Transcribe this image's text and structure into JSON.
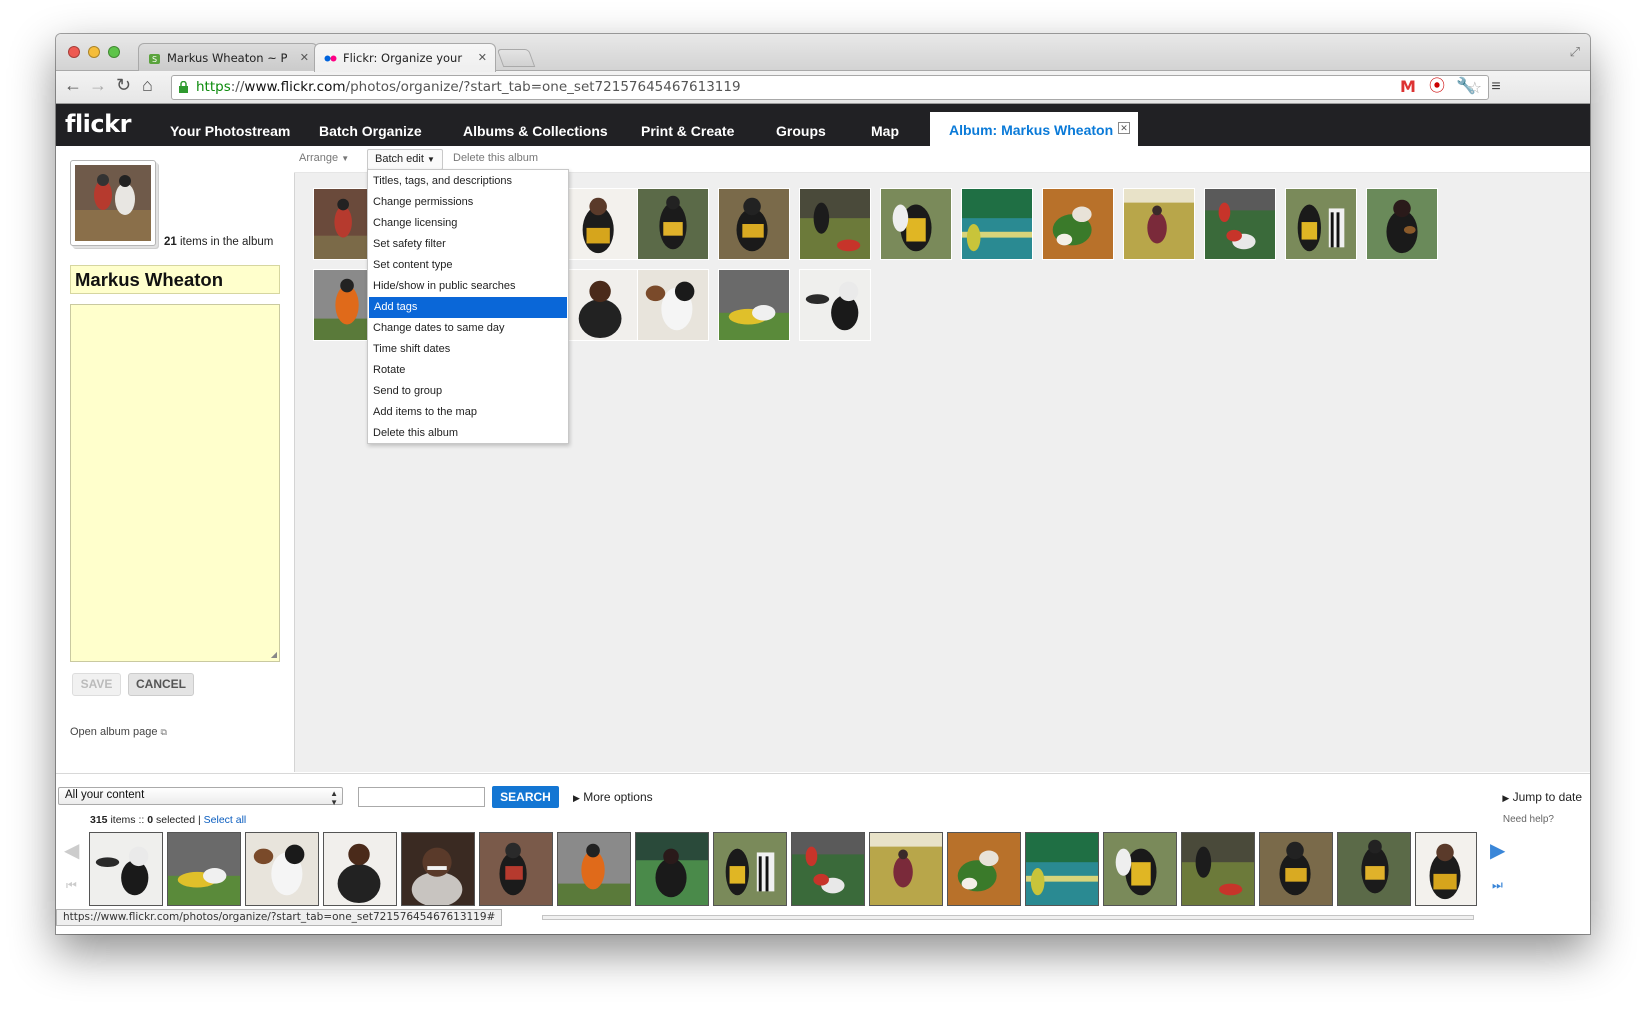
{
  "browser": {
    "tabs": [
      {
        "title": "Markus Wheaton ~ Pages -",
        "active": false
      },
      {
        "title": "Flickr: Organize your phot",
        "active": true
      }
    ],
    "url_https": "https",
    "url_sep": "://",
    "url_domain": "www.flickr.com",
    "url_path": "/photos/organize/?start_tab=one_set72157645467613119",
    "status_url": "https://www.flickr.com/photos/organize/?start_tab=one_set72157645467613119#"
  },
  "flickr_nav": {
    "logo": "flickr",
    "items": [
      "Your Photostream",
      "Batch Organize",
      "Albums & Collections",
      "Print & Create",
      "Groups",
      "Map"
    ],
    "album_tab": "Album: Markus Wheaton"
  },
  "sidebar": {
    "items_count": "21",
    "items_suffix": " items in the album",
    "album_title": "Markus Wheaton",
    "save_label": "SAVE",
    "cancel_label": "CANCEL",
    "open_album": "Open album page"
  },
  "toolbar": {
    "arrange": "Arrange",
    "batch_edit": "Batch edit",
    "delete_album": "Delete this album"
  },
  "batch_menu": {
    "items": [
      "Titles, tags, and descriptions",
      "Change permissions",
      "Change licensing",
      "Set safety filter",
      "Set content type",
      "Hide/show in public searches",
      "Add tags",
      "Change dates to same day",
      "Time shift dates",
      "Rotate",
      "Send to group",
      "Add items to the map",
      "Delete this album"
    ],
    "highlighted": "Add tags"
  },
  "bottom": {
    "filter": "All your content",
    "search_label": "SEARCH",
    "more_options": "More options",
    "jump_to_date": "Jump to date",
    "total_count": "315",
    "items_label": " items :: ",
    "selected_count": "0",
    "selected_label": " selected | ",
    "select_all": "Select all",
    "need_help": "Need help?"
  },
  "colors": {
    "flickr_nav_bg": "#212124",
    "album_tab_text": "#0a7ad8",
    "menu_highlight": "#0a67d8",
    "search_button": "#1376d3",
    "note_yellow": "#ffffcc"
  }
}
